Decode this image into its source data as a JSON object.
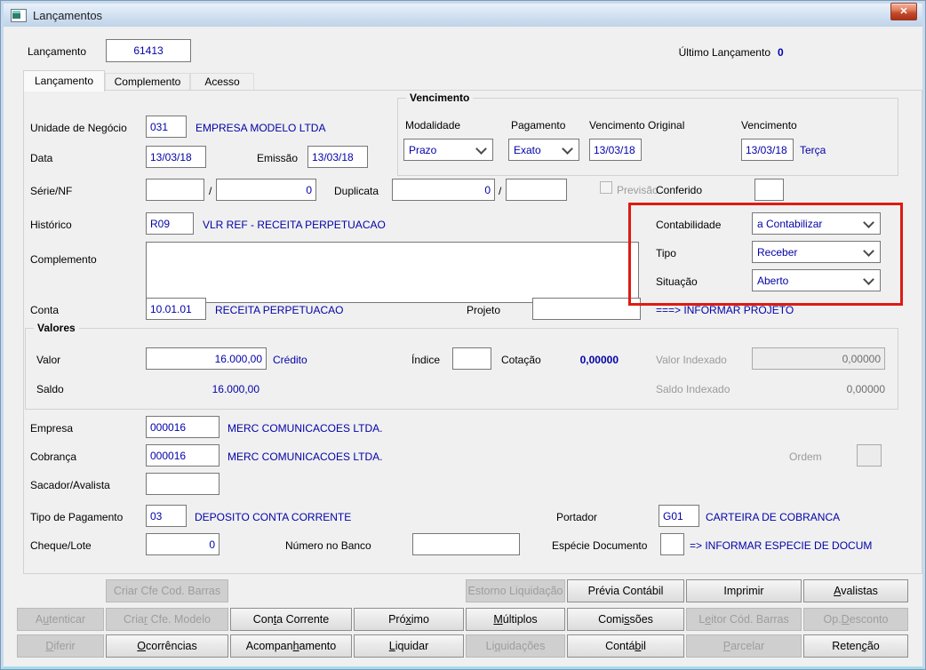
{
  "window": {
    "title": "Lançamentos",
    "close_icon": "✕"
  },
  "header": {
    "lancamento_label": "Lançamento",
    "lancamento_value": "61413",
    "ultimo_lancamento_label": "Último Lançamento",
    "ultimo_lancamento_value": "0"
  },
  "tabs": [
    {
      "label": "Lançamento"
    },
    {
      "label": "Complemento"
    },
    {
      "label": "Acesso"
    }
  ],
  "form": {
    "unidade_negocio": {
      "label": "Unidade de Negócio",
      "code": "031",
      "desc": "EMPRESA MODELO LTDA"
    },
    "data": {
      "label": "Data",
      "value": "13/03/18"
    },
    "emissao": {
      "label": "Emissão",
      "value": "13/03/18"
    },
    "vencimento_group": {
      "title": "Vencimento",
      "modalidade_label": "Modalidade",
      "modalidade_value": "Prazo",
      "pagamento_label": "Pagamento",
      "pagamento_value": "Exato",
      "vencimento_original_label": "Vencimento Original",
      "vencimento_original_value": "13/03/18",
      "vencimento_label": "Vencimento",
      "vencimento_value": "13/03/18",
      "vencimento_weekday": "Terça"
    },
    "serie_nf": {
      "label": "Série/NF",
      "serie_value": "",
      "slash": "/",
      "nf_value": "0"
    },
    "duplicata": {
      "label": "Duplicata",
      "value": "0",
      "slash": "/",
      "parcela_value": ""
    },
    "previsao": {
      "label": "Previsão",
      "checked": false
    },
    "conferido": {
      "label": "Conferido",
      "value": ""
    },
    "historico": {
      "label": "Histórico",
      "code": "R09",
      "desc": "VLR REF - RECEITA PERPETUACAO"
    },
    "contabilidade": {
      "label": "Contabilidade",
      "value": "a Contabilizar"
    },
    "tipo": {
      "label": "Tipo",
      "value": "Receber"
    },
    "situacao": {
      "label": "Situação",
      "value": "Aberto"
    },
    "complemento": {
      "label": "Complemento",
      "value": ""
    },
    "conta": {
      "label": "Conta",
      "code": "10.01.01",
      "desc": "RECEITA PERPETUACAO"
    },
    "projeto": {
      "label": "Projeto",
      "value": "",
      "hint": "===> INFORMAR PROJETO"
    },
    "valores_group": {
      "title": "Valores",
      "valor_label": "Valor",
      "valor_value": "16.000,00",
      "valor_tipo": "Crédito",
      "indice_label": "Índice",
      "indice_value": "",
      "cotacao_label": "Cotação",
      "cotacao_value": "0,00000",
      "valor_indexado_label": "Valor Indexado",
      "valor_indexado_value": "0,00000",
      "saldo_label": "Saldo",
      "saldo_value": "16.000,00",
      "saldo_indexado_label": "Saldo Indexado",
      "saldo_indexado_value": "0,00000"
    },
    "empresa": {
      "label": "Empresa",
      "code": "000016",
      "desc": "MERC COMUNICACOES LTDA."
    },
    "cobranca": {
      "label": "Cobrança",
      "code": "000016",
      "desc": "MERC COMUNICACOES LTDA."
    },
    "ordem": {
      "label": "Ordem",
      "value": ""
    },
    "sacador_avalista": {
      "label": "Sacador/Avalista",
      "value": ""
    },
    "tipo_pagamento": {
      "label": "Tipo de Pagamento",
      "code": "03",
      "desc": "DEPOSITO CONTA CORRENTE"
    },
    "portador": {
      "label": "Portador",
      "code": "G01",
      "desc": "CARTEIRA DE COBRANCA"
    },
    "cheque_lote": {
      "label": "Cheque/Lote",
      "value": "0"
    },
    "numero_banco": {
      "label": "Número no Banco",
      "value": ""
    },
    "especie_documento": {
      "label": "Espécie Documento",
      "value": "",
      "hint": "=> INFORMAR ESPECIE DE DOCUM"
    }
  },
  "colors": {
    "value_navy": "#0202A8",
    "annotation_red": "#DE1B12"
  },
  "buttons": [
    {
      "label": "Criar Cfe Cod. Barras",
      "row": 1,
      "col": 2,
      "enabled": false,
      "key": -1
    },
    {
      "label": "Estorno Liquidação",
      "row": 1,
      "col": 5,
      "enabled": false,
      "key": -1
    },
    {
      "label": "Prévia Contábil",
      "row": 1,
      "col": 6,
      "enabled": true,
      "key": -1
    },
    {
      "label": "Imprimir",
      "row": 1,
      "col": 7,
      "enabled": true,
      "key": -1
    },
    {
      "label": "Avalistas",
      "row": 1,
      "col": 8,
      "enabled": true,
      "key": 0
    },
    {
      "label": "Autenticar",
      "row": 2,
      "col": 1,
      "enabled": false,
      "key": 1
    },
    {
      "label": "Criar Cfe. Modelo",
      "row": 2,
      "col": 2,
      "enabled": false,
      "key": 4
    },
    {
      "label": "Conta Corrente",
      "row": 2,
      "col": 3,
      "enabled": true,
      "key": 3
    },
    {
      "label": "Próximo",
      "row": 2,
      "col": 4,
      "enabled": true,
      "key": 3
    },
    {
      "label": "Múltiplos",
      "row": 2,
      "col": 5,
      "enabled": true,
      "key": 0
    },
    {
      "label": "Comissões",
      "row": 2,
      "col": 6,
      "enabled": true,
      "key": 4
    },
    {
      "label": "Leitor Cód. Barras",
      "row": 2,
      "col": 7,
      "enabled": false,
      "key": 1
    },
    {
      "label": "Op.Desconto",
      "row": 2,
      "col": 8,
      "enabled": false,
      "key": 3
    },
    {
      "label": "Diferir",
      "row": 3,
      "col": 1,
      "enabled": false,
      "key": 0
    },
    {
      "label": "Ocorrências",
      "row": 3,
      "col": 2,
      "enabled": true,
      "key": 0
    },
    {
      "label": "Acompanhamento",
      "row": 3,
      "col": 3,
      "enabled": true,
      "key": 7
    },
    {
      "label": "Liquidar",
      "row": 3,
      "col": 4,
      "enabled": true,
      "key": 0
    },
    {
      "label": "Liquidações",
      "row": 3,
      "col": 5,
      "enabled": false,
      "key": 2
    },
    {
      "label": "Contábil",
      "row": 3,
      "col": 6,
      "enabled": true,
      "key": 5
    },
    {
      "label": "Parcelar",
      "row": 3,
      "col": 7,
      "enabled": false,
      "key": 0
    },
    {
      "label": "Retenção",
      "row": 3,
      "col": 8,
      "enabled": true,
      "key": 5
    }
  ]
}
